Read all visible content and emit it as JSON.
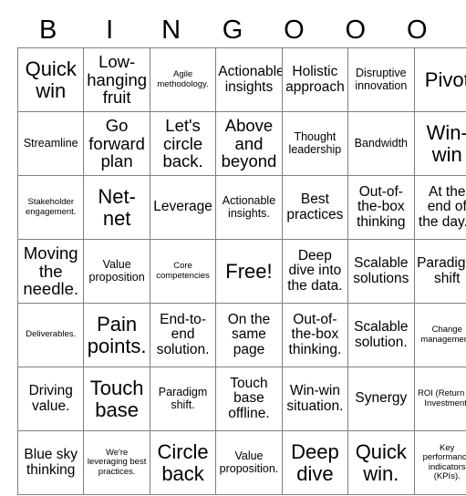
{
  "header": {
    "letters": [
      "B",
      "I",
      "N",
      "G",
      "O",
      "O",
      "O"
    ]
  },
  "grid": {
    "columns": 7,
    "rows": 7,
    "free_space": "Free!",
    "cells": [
      [
        {
          "text": "Quick win",
          "size": "xl"
        },
        {
          "text": "Low-hanging fruit",
          "size": "lg"
        },
        {
          "text": "Agile methodology.",
          "size": "xs"
        },
        {
          "text": "Actionable insights",
          "size": "md"
        },
        {
          "text": "Holistic approach",
          "size": "md"
        },
        {
          "text": "Disruptive innovation",
          "size": "sm"
        },
        {
          "text": "Pivot",
          "size": "xl"
        }
      ],
      [
        {
          "text": "Streamline",
          "size": "sm"
        },
        {
          "text": "Go forward plan",
          "size": "lg"
        },
        {
          "text": "Let's circle back.",
          "size": "lg"
        },
        {
          "text": "Above and beyond",
          "size": "lg"
        },
        {
          "text": "Thought leadership",
          "size": "sm"
        },
        {
          "text": "Bandwidth",
          "size": "sm"
        },
        {
          "text": "Win-win",
          "size": "xl"
        }
      ],
      [
        {
          "text": "Stakeholder engagement.",
          "size": "xs"
        },
        {
          "text": "Net-net",
          "size": "xl"
        },
        {
          "text": "Leverage",
          "size": "md"
        },
        {
          "text": "Actionable insights.",
          "size": "sm"
        },
        {
          "text": "Best practices",
          "size": "md"
        },
        {
          "text": "Out-of-the-box thinking",
          "size": "md"
        },
        {
          "text": "At the end of the day...",
          "size": "md"
        }
      ],
      [
        {
          "text": "Moving the needle.",
          "size": "lg"
        },
        {
          "text": "Value proposition",
          "size": "sm"
        },
        {
          "text": "Core competencies",
          "size": "xs"
        },
        {
          "text": "Free!",
          "size": "xl"
        },
        {
          "text": "Deep dive into the data.",
          "size": "md"
        },
        {
          "text": "Scalable solutions",
          "size": "md"
        },
        {
          "text": "Paradigm shift",
          "size": "md"
        }
      ],
      [
        {
          "text": "Deliverables.",
          "size": "xs"
        },
        {
          "text": "Pain points.",
          "size": "xl"
        },
        {
          "text": "End-to-end solution.",
          "size": "md"
        },
        {
          "text": "On the same page",
          "size": "md"
        },
        {
          "text": "Out-of-the-box thinking.",
          "size": "md"
        },
        {
          "text": "Scalable solution.",
          "size": "md"
        },
        {
          "text": "Change management.",
          "size": "xs"
        }
      ],
      [
        {
          "text": "Driving value.",
          "size": "md"
        },
        {
          "text": "Touch base",
          "size": "xl"
        },
        {
          "text": "Paradigm shift.",
          "size": "sm"
        },
        {
          "text": "Touch base offline.",
          "size": "md"
        },
        {
          "text": "Win-win situation.",
          "size": "md"
        },
        {
          "text": "Synergy",
          "size": "md"
        },
        {
          "text": "ROI (Return on Investment)",
          "size": "xs"
        }
      ],
      [
        {
          "text": "Blue sky thinking",
          "size": "md"
        },
        {
          "text": "We're leveraging best practices.",
          "size": "xs"
        },
        {
          "text": "Circle back",
          "size": "xl"
        },
        {
          "text": "Value proposition.",
          "size": "sm"
        },
        {
          "text": "Deep dive",
          "size": "xl"
        },
        {
          "text": "Quick win.",
          "size": "xl"
        },
        {
          "text": "Key performance indicators (KPIs).",
          "size": "xs"
        }
      ]
    ]
  }
}
